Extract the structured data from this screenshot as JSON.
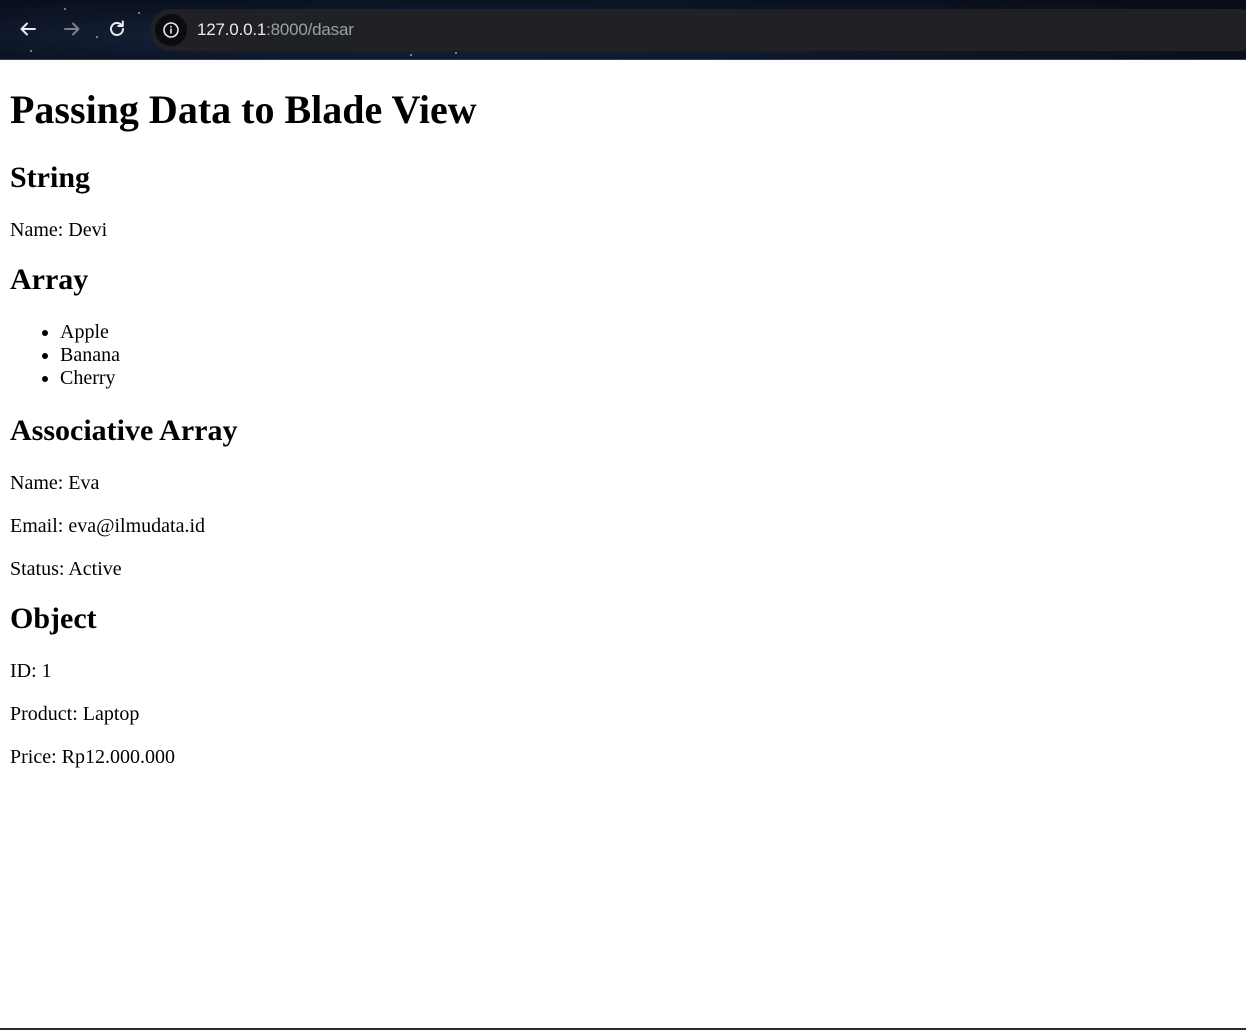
{
  "browser": {
    "url_host": "127.0.0.1",
    "url_rest": ":8000/dasar",
    "icons": {
      "back": "back-arrow-icon",
      "forward": "forward-arrow-icon",
      "reload": "reload-icon",
      "site_info": "info-icon"
    }
  },
  "page": {
    "title": "Passing Data to Blade View",
    "sections": {
      "string": {
        "heading": "String",
        "name_line": "Name: Devi"
      },
      "array": {
        "heading": "Array",
        "items": [
          "Apple",
          "Banana",
          "Cherry"
        ]
      },
      "assoc": {
        "heading": "Associative Array",
        "name_line": "Name: Eva",
        "email_line": "Email: eva@ilmudata.id",
        "status_line": "Status: Active"
      },
      "object": {
        "heading": "Object",
        "id_line": "ID: 1",
        "product_line": "Product: Laptop",
        "price_line": "Price: Rp12.000.000"
      }
    }
  }
}
